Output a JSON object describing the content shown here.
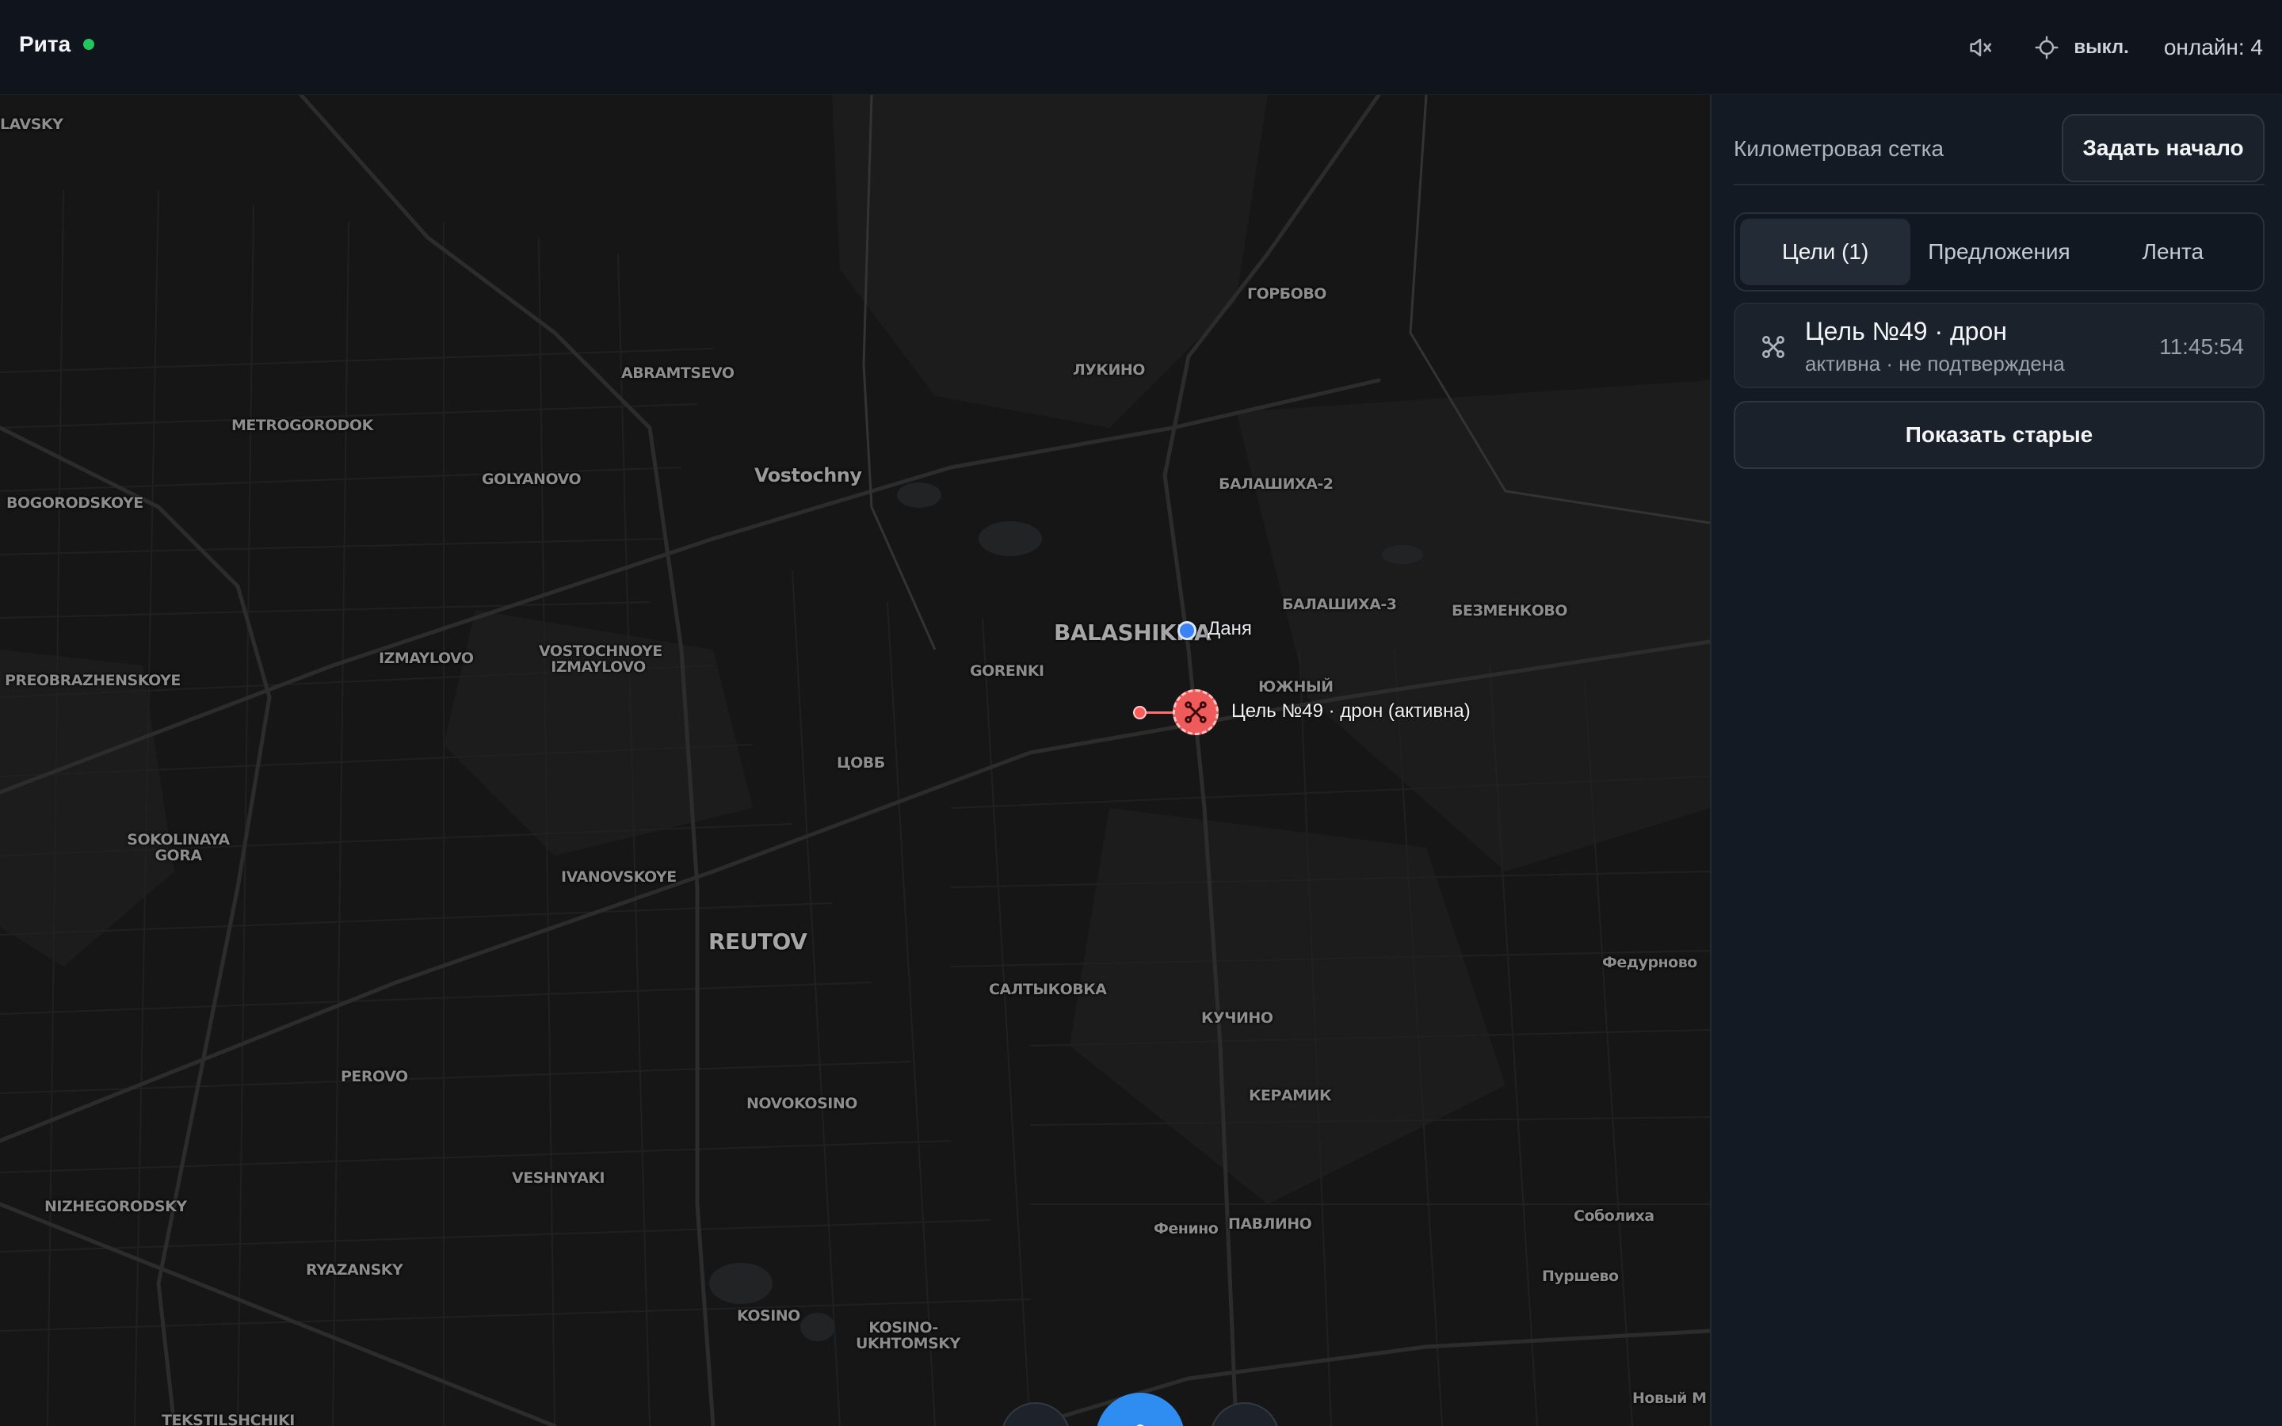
{
  "header": {
    "user_name": "Рита",
    "location_toggle_label": "выкл.",
    "online_label": "онлайн: 4"
  },
  "map": {
    "places": [
      "LAVSKY",
      "ГОРБОВО",
      "ABRAMTSEVO",
      "ЛУКИНО",
      "METROGORODOK",
      "GOLYANOVO",
      "Vostochny",
      "BOGORODSKOYE",
      "БАЛАШИХА-2",
      "BALASHIKHA",
      "БАЛАШИХА-3",
      "БЕЗМЕНКОВО",
      "IZMAYLOVO",
      "VOSTOCHNOYE IZMAYLOVO",
      "GORENKI",
      "ЮЖНЫЙ",
      "PREOBRAZHENSKOYE",
      "ЦОВБ",
      "SOKOLINAYA GORA",
      "IVANOVSKOYE",
      "REUTOV",
      "Федурново",
      "САЛТЫКОВКА",
      "КУЧИНО",
      "PEROVO",
      "КЕРАМИК",
      "NOVOKOSINO",
      "VESHNYAKI",
      "NIZHEGORODSKY",
      "Соболиха",
      "Фенино",
      "ПАВЛИНО",
      "RYAZANSKY",
      "Пуршево",
      "KOSINO",
      "KOSINO-UKHTOMSKY",
      "Новый М",
      "TEKSTILSHCHIKI"
    ],
    "user_marker_label": "Даня",
    "target_marker_label": "Цель №49 · дрон (активна)"
  },
  "sidebar": {
    "grid_label": "Километровая сетка",
    "set_origin_label": "Задать начало",
    "tabs": [
      {
        "label": "Цели (1)",
        "active": true
      },
      {
        "label": "Предложения",
        "active": false
      },
      {
        "label": "Лента",
        "active": false
      }
    ],
    "targets": [
      {
        "icon": "drone-icon",
        "title": "Цель №49 · дрон",
        "status": "активна · не подтверждена",
        "time": "11:45:54"
      }
    ],
    "show_old_label": "Показать старые"
  },
  "colors": {
    "accent": "#2f8cf0",
    "target": "#ef5b5b",
    "online": "#22c55e",
    "user_marker": "#3b82f6"
  }
}
